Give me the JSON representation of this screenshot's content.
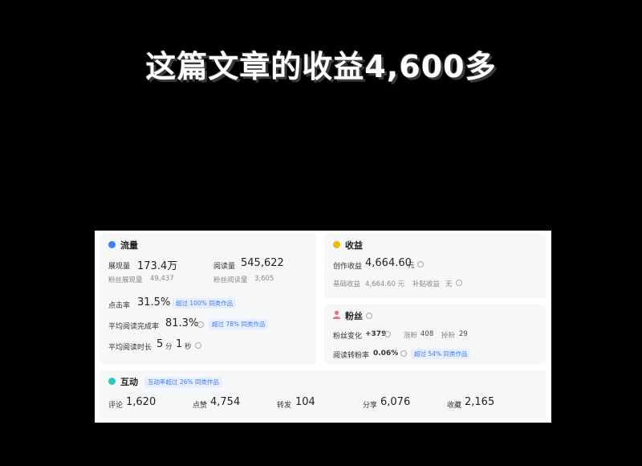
{
  "headline": "这篇文章的收益4,600多",
  "colors": {
    "traffic_dot": "#3b82f6",
    "income_dot": "#f5b800",
    "fans_icon": "#f06b7a",
    "interact_dot": "#2fc6c0",
    "badge": "#3d7bf0"
  },
  "traffic": {
    "title": "流量",
    "impressions_label": "展现量",
    "impressions_value": "173.4万",
    "reads_label": "阅读量",
    "reads_value": "545,622",
    "fan_impressions_label": "粉丝展现量",
    "fan_impressions_value": "49,437",
    "fan_reads_label": "粉丝阅读量",
    "fan_reads_value": "3,605",
    "ctr_label": "点击率",
    "ctr_value": "31.5%",
    "ctr_badge": "超过 100% 同类作品",
    "completion_label": "平均阅读完成率",
    "completion_value": "81.3%",
    "completion_badge": "超过 78% 同类作品",
    "duration_label": "平均阅读时长",
    "duration_min": "5",
    "duration_min_unit": "分",
    "duration_sec": "1",
    "duration_sec_unit": "秒"
  },
  "income": {
    "title": "收益",
    "creation_label": "创作收益",
    "creation_value": "4,664.60",
    "creation_unit": "元",
    "base_label": "基础收益",
    "base_value": "4,664.60 元",
    "subsidy_label": "补贴收益",
    "subsidy_value": "无"
  },
  "fans": {
    "title": "粉丝",
    "change_label": "粉丝变化",
    "change_value": "+379",
    "gain_label": "涨粉",
    "gain_value": "408",
    "loss_label": "掉粉",
    "loss_value": "29",
    "conv_label": "阅读转粉率",
    "conv_value": "0.06%",
    "conv_badge": "超过 54% 同类作品"
  },
  "interaction": {
    "title": "互动",
    "badge": "互动率超过 26% 同类作品",
    "comments_label": "评论",
    "comments_value": "1,620",
    "likes_label": "点赞",
    "likes_value": "4,754",
    "reposts_label": "转发",
    "reposts_value": "104",
    "shares_label": "分享",
    "shares_value": "6,076",
    "favs_label": "收藏",
    "favs_value": "2,165"
  }
}
